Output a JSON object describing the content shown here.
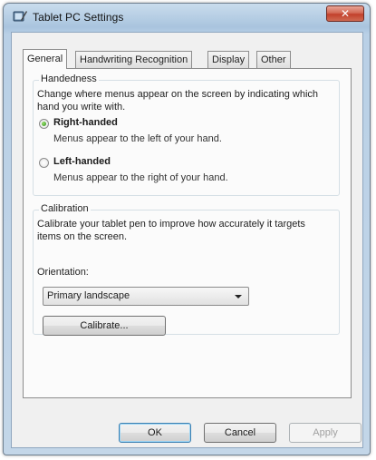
{
  "window": {
    "title": "Tablet PC Settings",
    "close_glyph": "✕"
  },
  "tabs": [
    {
      "label": "General",
      "active": true
    },
    {
      "label": "Handwriting Recognition",
      "active": false
    },
    {
      "label": "Display",
      "active": false
    },
    {
      "label": "Other",
      "active": false
    }
  ],
  "handedness": {
    "group_label": "Handedness",
    "description": "Change where menus appear on the screen by indicating which hand you write with.",
    "options": [
      {
        "label": "Right-handed",
        "sub": "Menus appear to the left of your hand.",
        "selected": true
      },
      {
        "label": "Left-handed",
        "sub": "Menus appear to the right of your hand.",
        "selected": false
      }
    ]
  },
  "calibration": {
    "group_label": "Calibration",
    "description": "Calibrate your tablet pen to improve how accurately it targets items on the screen.",
    "orientation_label": "Orientation:",
    "orientation_value": "Primary landscape",
    "calibrate_button": "Calibrate..."
  },
  "footer": {
    "ok": "OK",
    "cancel": "Cancel",
    "apply": "Apply"
  },
  "colors": {
    "title_bar": "#a9c4de",
    "close_button": "#c2402b",
    "selected_radio": "#2a8a1c"
  },
  "icons": {
    "window_icon": "tablet-pen-icon",
    "close_icon": "close-icon",
    "dropdown_icon": "chevron-down-icon"
  }
}
